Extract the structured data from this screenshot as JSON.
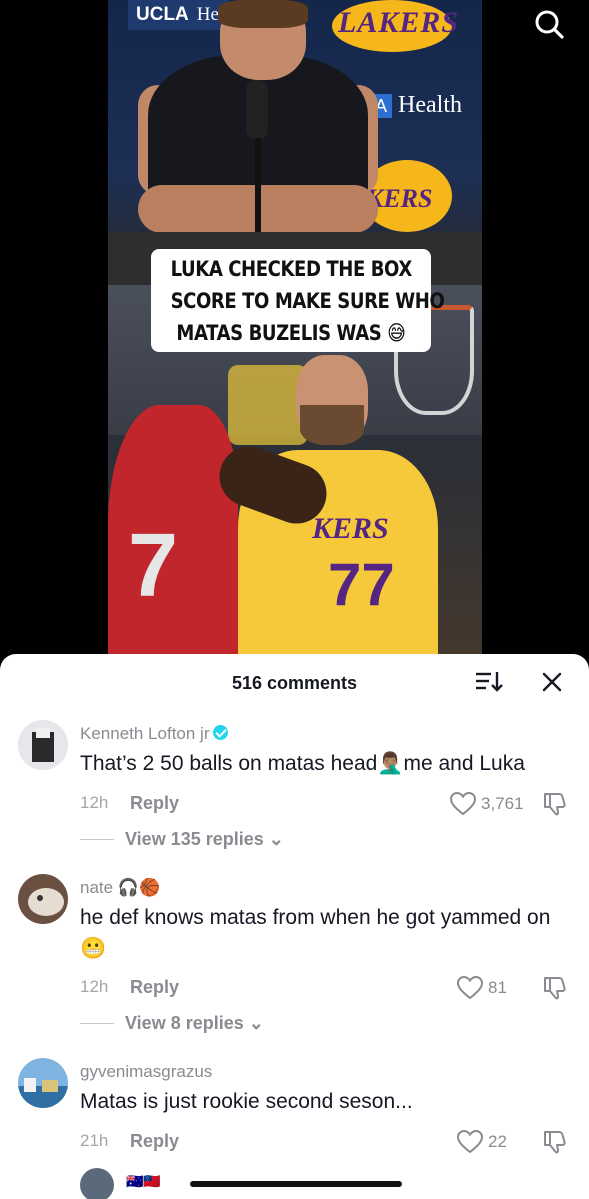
{
  "video": {
    "caption_lines": [
      "LUKA CHECKED THE BOX",
      "SCORE TO MAKE SURE WHO",
      "MATAS BUZELIS WAS 😅"
    ],
    "backdrop": {
      "ucla_text": "UCLA",
      "ucla_text_rest": "He",
      "lakers_text": "LAKERS",
      "health_prefix": "A",
      "health_text": "Health",
      "jersey_text": "KERS",
      "jersey_number": "77",
      "opponent_number": "7"
    },
    "search_icon": "search-icon"
  },
  "comments_sheet": {
    "count_label": "516 comments",
    "sort_icon": "sort-icon",
    "close_icon": "close-icon",
    "comments": [
      {
        "username": "Kenneth Lofton jr",
        "verified": true,
        "text_before": "That’s 2 50 balls on matas head",
        "emoji": "🤦🏽‍♂️",
        "text_after": "me and Luka",
        "time": "12h",
        "reply_label": "Reply",
        "likes": "3,761",
        "view_replies": "View 135 replies"
      },
      {
        "username": "nate",
        "username_emojis": "🎧🏀",
        "text": "he def knows matas from when he got yammed on",
        "text_emoji": "😬",
        "time": "12h",
        "reply_label": "Reply",
        "likes": "81",
        "view_replies": "View 8 replies"
      },
      {
        "username": "gyvenimasgrazus",
        "text": "Matas is just rookie second seson...",
        "time": "21h",
        "reply_label": "Reply",
        "likes": "22"
      }
    ],
    "next_user_flags": "🇦🇺🇼🇸"
  }
}
